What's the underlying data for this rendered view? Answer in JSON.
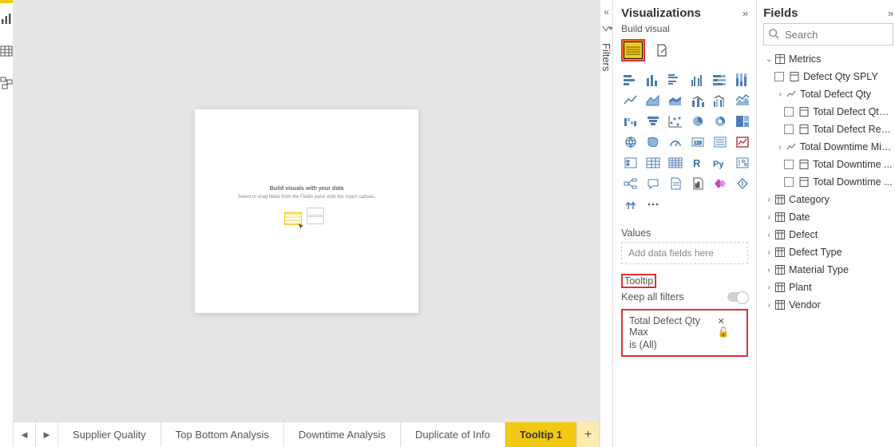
{
  "left_rail": {
    "icons": [
      "report",
      "table",
      "model"
    ]
  },
  "collapsed_panel": {
    "label": "Filters"
  },
  "canvas": {
    "title": "Build visuals with your data",
    "subtitle": "Select or drag fields from the Fields pane onto the report canvas."
  },
  "tabs": {
    "items": [
      "Supplier Quality",
      "Top Bottom Analysis",
      "Downtime Analysis",
      "Duplicate of Info",
      "Tooltip 1"
    ],
    "active_index": 4
  },
  "viz_panel": {
    "title": "Visualizations",
    "build_label": "Build visual",
    "values_label": "Values",
    "values_placeholder": "Add data fields here",
    "tooltip_label": "Tooltip",
    "keep_filters_label": "Keep all filters",
    "toggle_on_label": "On",
    "tooltip_field_name": "Total Defect Qty Max",
    "tooltip_field_scope": "is (All)"
  },
  "fields_panel": {
    "title": "Fields",
    "search_placeholder": "Search",
    "tree": {
      "metrics": {
        "label": "Metrics",
        "children": [
          {
            "type": "measure",
            "label": "Defect Qty SPLY"
          },
          {
            "type": "group",
            "label": "Total Defect Qty",
            "children": [
              {
                "type": "measure",
                "label": "Total Defect Qty ..."
              },
              {
                "type": "measure",
                "label": "Total Defect Rep..."
              }
            ]
          },
          {
            "type": "group",
            "label": "Total Downtime Min...",
            "children": [
              {
                "type": "measure",
                "label": "Total Downtime ..."
              },
              {
                "type": "measure",
                "label": "Total Downtime ..."
              }
            ]
          }
        ]
      },
      "tables": [
        "Category",
        "Date",
        "Defect",
        "Defect Type",
        "Material Type",
        "Plant",
        "Vendor"
      ]
    }
  }
}
